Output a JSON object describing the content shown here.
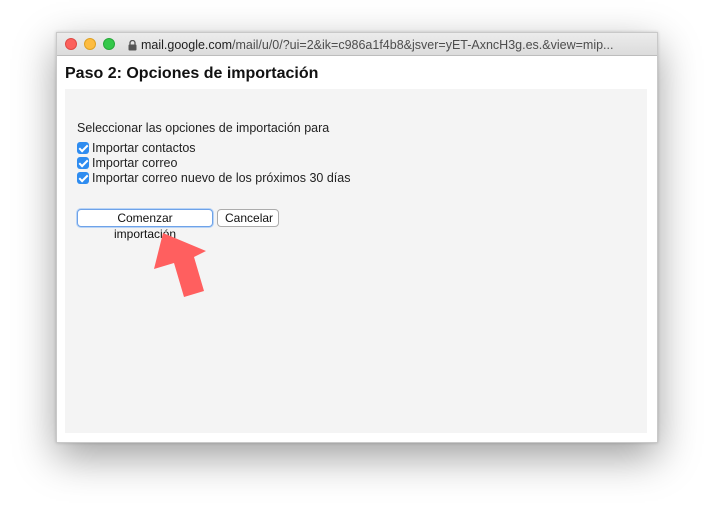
{
  "browser": {
    "url_host": "mail.google.com",
    "url_path": "/mail/u/0/?ui=2&ik=c986a1f4b8&jsver=yET-AxncH3g.es.&view=mip..."
  },
  "page": {
    "title": "Paso 2: Opciones de importación",
    "intro": "Seleccionar las opciones de importación para",
    "options": [
      {
        "label": "Importar contactos",
        "checked": true
      },
      {
        "label": "Importar correo",
        "checked": true
      },
      {
        "label": "Importar correo nuevo de los próximos 30 días",
        "checked": true
      }
    ],
    "buttons": {
      "start": "Comenzar importación",
      "cancel": "Cancelar"
    }
  },
  "colors": {
    "checkbox": "#2e8cf0",
    "arrow": "#ff5f5f",
    "panel_bg": "#f4f4f4"
  },
  "icons": [
    "lock-icon",
    "annotation-arrow-icon",
    "watermark-logo-icon"
  ]
}
